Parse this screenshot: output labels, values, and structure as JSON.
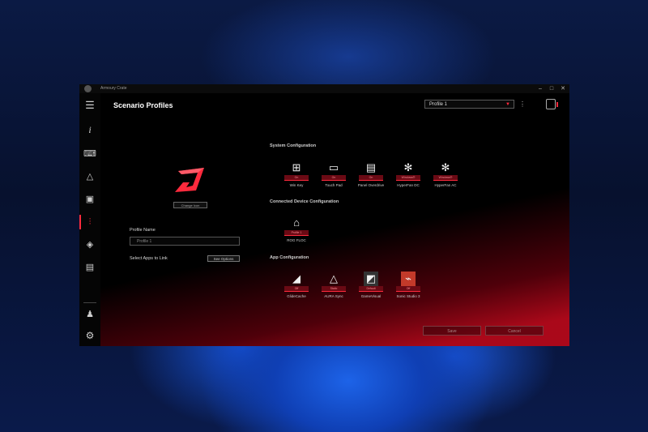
{
  "window": {
    "title": "Armoury Crate"
  },
  "page": {
    "title": "Scenario Profiles"
  },
  "header": {
    "profile_selected": "Profile 1"
  },
  "left_panel": {
    "change_icon_label": "Change Icon",
    "profile_name_label": "Profile Name",
    "profile_name_value": "Profile 1",
    "select_apps_label": "Select Apps to Link",
    "see_options_label": "See Options"
  },
  "sections": {
    "system": {
      "title": "System Configuration",
      "items": [
        {
          "name": "Win Key",
          "status": "On",
          "icon": "windows-icon"
        },
        {
          "name": "Touch Pad",
          "status": "On",
          "icon": "touchpad-icon"
        },
        {
          "name": "Panel Overdrive",
          "status": "On",
          "icon": "panel-icon"
        },
        {
          "name": "HyperFan DC",
          "status": "Windows®",
          "icon": "fan-icon"
        },
        {
          "name": "HyperFan AC",
          "status": "Windows®",
          "icon": "fan-ac-icon"
        }
      ]
    },
    "device": {
      "title": "Connected Device Configuration",
      "items": [
        {
          "name": "ROG FLOC",
          "status": "Profile 1",
          "icon": "mouse-icon"
        }
      ]
    },
    "app": {
      "title": "App Configuration",
      "items": [
        {
          "name": "GlideCache",
          "status": "Off",
          "icon": "glide-icon"
        },
        {
          "name": "AURA Sync",
          "status": "Static",
          "icon": "aura-icon"
        },
        {
          "name": "GameVisual",
          "status": "Default",
          "icon": "gamevisual-icon"
        },
        {
          "name": "Sonic Studio 3",
          "status": "Off",
          "icon": "sonic-icon"
        }
      ]
    }
  },
  "footer": {
    "save_label": "Save",
    "cancel_label": "Cancel"
  },
  "colors": {
    "accent": "#ff2a3d",
    "background": "#000000"
  }
}
